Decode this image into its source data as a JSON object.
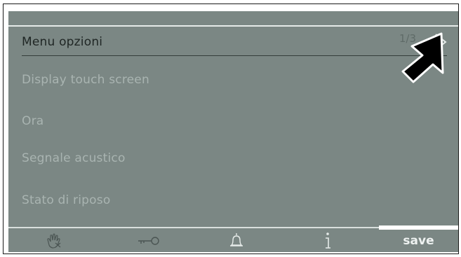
{
  "header": {
    "title": "Menu opzioni",
    "page": "1/3"
  },
  "menu": {
    "items": [
      {
        "label": "Display touch screen"
      },
      {
        "label": "Ora"
      },
      {
        "label": "Segnale acustico"
      },
      {
        "label": "Stato di riposo"
      }
    ]
  },
  "footer": {
    "icons": [
      "hand-touch-icon",
      "key-icon",
      "bell-icon",
      "info-icon"
    ],
    "save_label": "save"
  },
  "colors": {
    "screen_bg": "#7b8784",
    "active_text": "#1f2624",
    "inactive_text": "#a9b4b1",
    "arrow": "#000000"
  }
}
